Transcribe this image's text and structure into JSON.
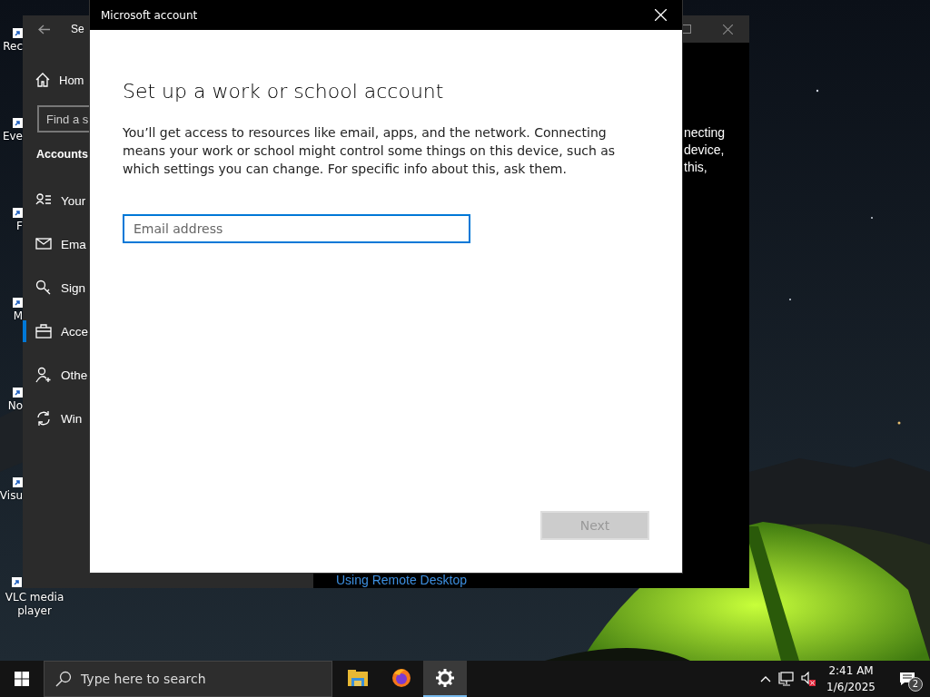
{
  "desktop_icons": [
    {
      "label": "Rec"
    },
    {
      "label": "Eve"
    },
    {
      "label": "F"
    },
    {
      "label": "M"
    },
    {
      "label": "No"
    },
    {
      "label": "Visu"
    },
    {
      "label": "VLC media player"
    }
  ],
  "settings_window": {
    "title": "Se",
    "home": "Hom",
    "search": {
      "placeholder": "Find a s"
    },
    "section": "Accounts",
    "items": [
      {
        "label": "Your",
        "kind": "info",
        "selected": false
      },
      {
        "label": "Ema",
        "kind": "mail",
        "selected": false
      },
      {
        "label": "Sign",
        "kind": "key",
        "selected": false
      },
      {
        "label": "Acce",
        "kind": "work",
        "selected": true
      },
      {
        "label": "Othe",
        "kind": "family",
        "selected": false
      },
      {
        "label": "Win",
        "kind": "sync",
        "selected": false
      }
    ],
    "body_fragments": [
      "necting",
      "device,",
      "this,"
    ],
    "link": "Using Remote Desktop"
  },
  "dialog": {
    "title": "Microsoft account",
    "heading": "Set up a work or school account",
    "description": "You’ll get access to resources like email, apps, and the network. Connecting means your work or school might control some things on this device, such as which settings you can change. For specific info about this, ask them.",
    "email": {
      "placeholder": "Email address",
      "focused": true
    },
    "next": {
      "label": "Next",
      "disabled": true
    }
  },
  "taskbar": {
    "search": {
      "placeholder": "Type here to search"
    },
    "apps": [
      {
        "kind": "folder",
        "selected": false
      },
      {
        "kind": "browser",
        "selected": false
      },
      {
        "kind": "settings",
        "selected": true
      }
    ],
    "time": "2:41 AM",
    "date": "1/6/2025",
    "notifications": "2"
  }
}
